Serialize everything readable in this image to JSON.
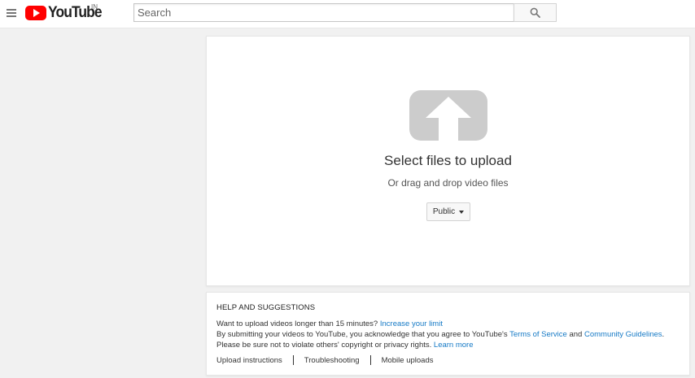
{
  "header": {
    "menu_icon": "hamburger-menu-icon",
    "logo_text": "YouTube",
    "region": "IN",
    "search": {
      "placeholder": "Search",
      "value": "",
      "button_icon": "search-icon"
    }
  },
  "upload": {
    "icon": "upload-arrow-icon",
    "title": "Select files to upload",
    "subtitle": "Or drag and drop video files",
    "privacy": {
      "selected": "Public",
      "icon": "caret-down-icon"
    }
  },
  "help": {
    "title": "HELP AND SUGGESTIONS",
    "line1_text": "Want to upload videos longer than 15 minutes?",
    "line1_link": "Increase your limit",
    "line2_text": "By submitting your videos to YouTube, you acknowledge that you agree to YouTube's",
    "line2_link1": "Terms of Service",
    "line2_and": "and",
    "line2_link2": "Community Guidelines",
    "line2_end": ".",
    "line3_text": "Please be sure not to violate others' copyright or privacy rights.",
    "line3_link": "Learn more",
    "links": [
      "Upload instructions",
      "Troubleshooting",
      "Mobile uploads"
    ]
  },
  "colors": {
    "brand_red": "#ff0000",
    "link_blue": "#167ac6",
    "page_bg": "#f1f1f1"
  }
}
